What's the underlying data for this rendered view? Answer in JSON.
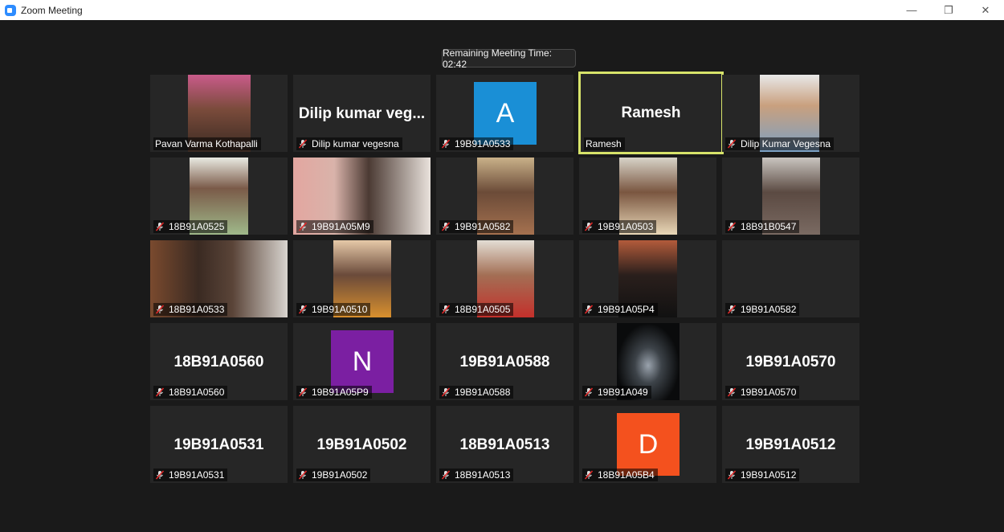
{
  "window": {
    "title": "Zoom Meeting",
    "minimize": "—",
    "restore": "❐",
    "close": "✕"
  },
  "timer": "Remaining Meeting Time: 02:42",
  "tiles": [
    {
      "label": "Pavan Varma Kothapalli",
      "muted": false,
      "big": "",
      "video": "portrait-warm"
    },
    {
      "label": "Dilip kumar vegesna",
      "muted": true,
      "big": "Dilip kumar veg...",
      "video": ""
    },
    {
      "label": "19B91A0533",
      "muted": true,
      "big": "",
      "avatar": {
        "letter": "A",
        "color": "#1a8fd6"
      }
    },
    {
      "label": "Ramesh",
      "muted": false,
      "big": "Ramesh",
      "active": true
    },
    {
      "label": "Dilip Kumar Vegesna",
      "muted": true,
      "big": "",
      "video": "portrait-window"
    },
    {
      "label": "18B91A0525",
      "muted": true,
      "big": "",
      "video": "portrait-green"
    },
    {
      "label": "19B91A05M9",
      "muted": true,
      "big": "",
      "video": "wide-pink"
    },
    {
      "label": "19B91A0582",
      "muted": true,
      "big": "",
      "video": "portrait-tan"
    },
    {
      "label": "19B91A0503",
      "muted": true,
      "big": "",
      "video": "portrait-light"
    },
    {
      "label": "18B91B0547",
      "muted": true,
      "big": "",
      "video": "portrait-gray"
    },
    {
      "label": "18B91A0533",
      "muted": true,
      "big": "",
      "video": "wide-brown"
    },
    {
      "label": "19B91A0510",
      "muted": true,
      "big": "",
      "video": "portrait-orange"
    },
    {
      "label": "18B91A0505",
      "muted": true,
      "big": "",
      "video": "portrait-red"
    },
    {
      "label": "19B91A05P4",
      "muted": true,
      "big": "",
      "video": "portrait-dark"
    },
    {
      "label": "19B91A0582",
      "muted": true,
      "big": "",
      "video": ""
    },
    {
      "label": "18B91A0560",
      "muted": true,
      "big": "18B91A0560"
    },
    {
      "label": "19B91A05P9",
      "muted": true,
      "big": "",
      "avatar": {
        "letter": "N",
        "color": "#7b1fa2"
      }
    },
    {
      "label": "19B91A0588",
      "muted": true,
      "big": "19B91A0588"
    },
    {
      "label": "19B91A049",
      "muted": true,
      "big": "",
      "video": "car"
    },
    {
      "label": "19B91A0570",
      "muted": true,
      "big": "19B91A0570"
    },
    {
      "label": "19B91A0531",
      "muted": true,
      "big": "19B91A0531"
    },
    {
      "label": "19B91A0502",
      "muted": true,
      "big": "19B91A0502"
    },
    {
      "label": "18B91A0513",
      "muted": true,
      "big": "18B91A0513"
    },
    {
      "label": "18B91A05B4",
      "muted": true,
      "big": "",
      "avatar": {
        "letter": "D",
        "color": "#f4511e"
      }
    },
    {
      "label": "19B91A0512",
      "muted": true,
      "big": "19B91A0512"
    }
  ]
}
